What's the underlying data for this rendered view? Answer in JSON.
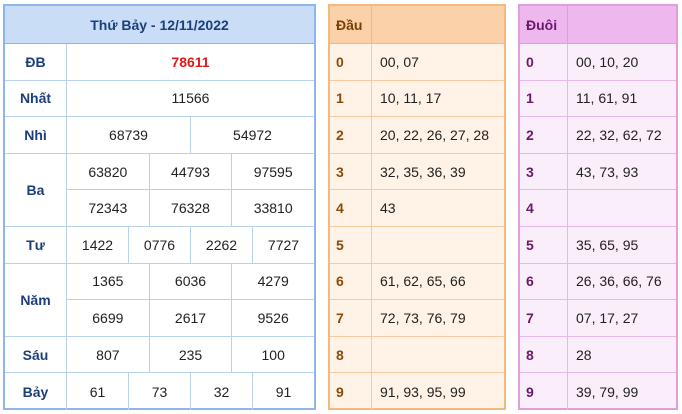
{
  "results": {
    "title": "Thứ Bảy - 12/11/2022",
    "rows": [
      {
        "label": "ĐB",
        "lines": [
          [
            "78611"
          ]
        ],
        "special": true
      },
      {
        "label": "Nhất",
        "lines": [
          [
            "11566"
          ]
        ]
      },
      {
        "label": "Nhì",
        "lines": [
          [
            "68739",
            "54972"
          ]
        ]
      },
      {
        "label": "Ba",
        "lines": [
          [
            "63820",
            "44793",
            "97595"
          ],
          [
            "72343",
            "76328",
            "33810"
          ]
        ]
      },
      {
        "label": "Tư",
        "lines": [
          [
            "1422",
            "0776",
            "2262",
            "7727"
          ]
        ]
      },
      {
        "label": "Năm",
        "lines": [
          [
            "1365",
            "6036",
            "4279"
          ],
          [
            "6699",
            "2617",
            "9526"
          ]
        ]
      },
      {
        "label": "Sáu",
        "lines": [
          [
            "807",
            "235",
            "100"
          ]
        ]
      },
      {
        "label": "Bảy",
        "lines": [
          [
            "61",
            "73",
            "32",
            "91"
          ]
        ]
      }
    ]
  },
  "dau": {
    "header": "Đầu",
    "rows": [
      {
        "key": "0",
        "value": "00, 07"
      },
      {
        "key": "1",
        "value": "10, 11, 17"
      },
      {
        "key": "2",
        "value": "20, 22, 26, 27, 28"
      },
      {
        "key": "3",
        "value": "32, 35, 36, 39"
      },
      {
        "key": "4",
        "value": "43"
      },
      {
        "key": "5",
        "value": ""
      },
      {
        "key": "6",
        "value": "61, 62, 65, 66"
      },
      {
        "key": "7",
        "value": "72, 73, 76, 79"
      },
      {
        "key": "8",
        "value": ""
      },
      {
        "key": "9",
        "value": "91, 93, 95, 99"
      }
    ]
  },
  "duoi": {
    "header": "Đuôi",
    "rows": [
      {
        "key": "0",
        "value": "00, 10, 20"
      },
      {
        "key": "1",
        "value": "11, 61, 91"
      },
      {
        "key": "2",
        "value": "22, 32, 62, 72"
      },
      {
        "key": "3",
        "value": "43, 73, 93"
      },
      {
        "key": "4",
        "value": ""
      },
      {
        "key": "5",
        "value": "35, 65, 95"
      },
      {
        "key": "6",
        "value": "26, 36, 66, 76"
      },
      {
        "key": "7",
        "value": "07, 17, 27"
      },
      {
        "key": "8",
        "value": "28"
      },
      {
        "key": "9",
        "value": "39, 79, 99"
      }
    ]
  },
  "colors": {
    "special_prize": "#e0191a",
    "results_accent": "#8fb6e6",
    "dau_accent": "#f5b97f",
    "duoi_accent": "#dda0dd"
  }
}
